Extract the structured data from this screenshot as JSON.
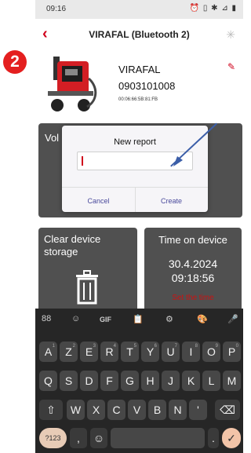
{
  "step_badge": "2",
  "status_bar": {
    "time": "09:16",
    "icons": "⏰ ▯ ✱ ⊿ ▮"
  },
  "app_bar": {
    "title": "VIRAFAL (Bluetooth 2)"
  },
  "device": {
    "name": "VIRAFAL",
    "serial": "0903101008",
    "mac": "00:06:66:5B:81:FB"
  },
  "tiles": {
    "volume_label": "Vol",
    "clear_label": "Clear device storage",
    "time_label": "Time on device",
    "date": "30.4.2024",
    "time": "09:18:56",
    "set_time": "Set the time"
  },
  "dialog": {
    "title": "New report",
    "input_value": "",
    "cancel": "Cancel",
    "create": "Create"
  },
  "keyboard": {
    "toolbar": [
      "88",
      "☺",
      "GIF",
      "📋",
      "⚙",
      "🎨",
      "🎤"
    ],
    "row1": [
      "A",
      "Z",
      "E",
      "R",
      "T",
      "Y",
      "U",
      "I",
      "O",
      "P"
    ],
    "row1_hints": [
      "1",
      "2",
      "3",
      "4",
      "5",
      "6",
      "7",
      "8",
      "9",
      "0"
    ],
    "row2": [
      "Q",
      "S",
      "D",
      "F",
      "G",
      "H",
      "J",
      "K",
      "L",
      "M"
    ],
    "row3": [
      "W",
      "X",
      "C",
      "V",
      "B",
      "N",
      "'"
    ],
    "shift": "⇧",
    "backspace": "⌫",
    "num_key": "?123",
    "comma": ",",
    "emoji": "☺",
    "period": ".",
    "enter": "✓"
  },
  "colors": {
    "accent": "#d0021b",
    "tile": "#505050",
    "keyboard": "#262626",
    "arrow": "#3b5ea8"
  }
}
